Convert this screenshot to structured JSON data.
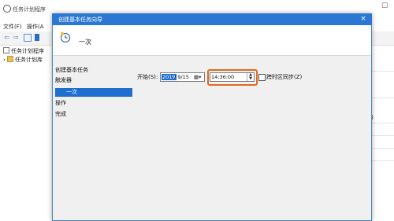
{
  "background_app": {
    "title": "任务计划程序",
    "menu": [
      "文件(F)",
      "操作(A"
    ],
    "tree": [
      "任务计划程序",
      "任务计划库"
    ],
    "right_panel_text": "务"
  },
  "dialog": {
    "title": "创建基本任务向导",
    "close_label": "×",
    "header_title": "一次",
    "steps": [
      "创建基本任务",
      "触发器",
      "一次",
      "操作",
      "完成"
    ],
    "selected_step": 2,
    "start_label": "开始(S):",
    "date": {
      "year": "2019",
      "rest": "/ 9/15",
      "dropdown": "▾"
    },
    "time": {
      "value": "14:36:00"
    },
    "sync_timezone_label": "跨时区同步(Z)",
    "sync_timezone_checked": false
  },
  "colors": {
    "title_bar": "#2b78d4",
    "selection": "#1e6fd0",
    "highlight_border": "#e06a22"
  }
}
